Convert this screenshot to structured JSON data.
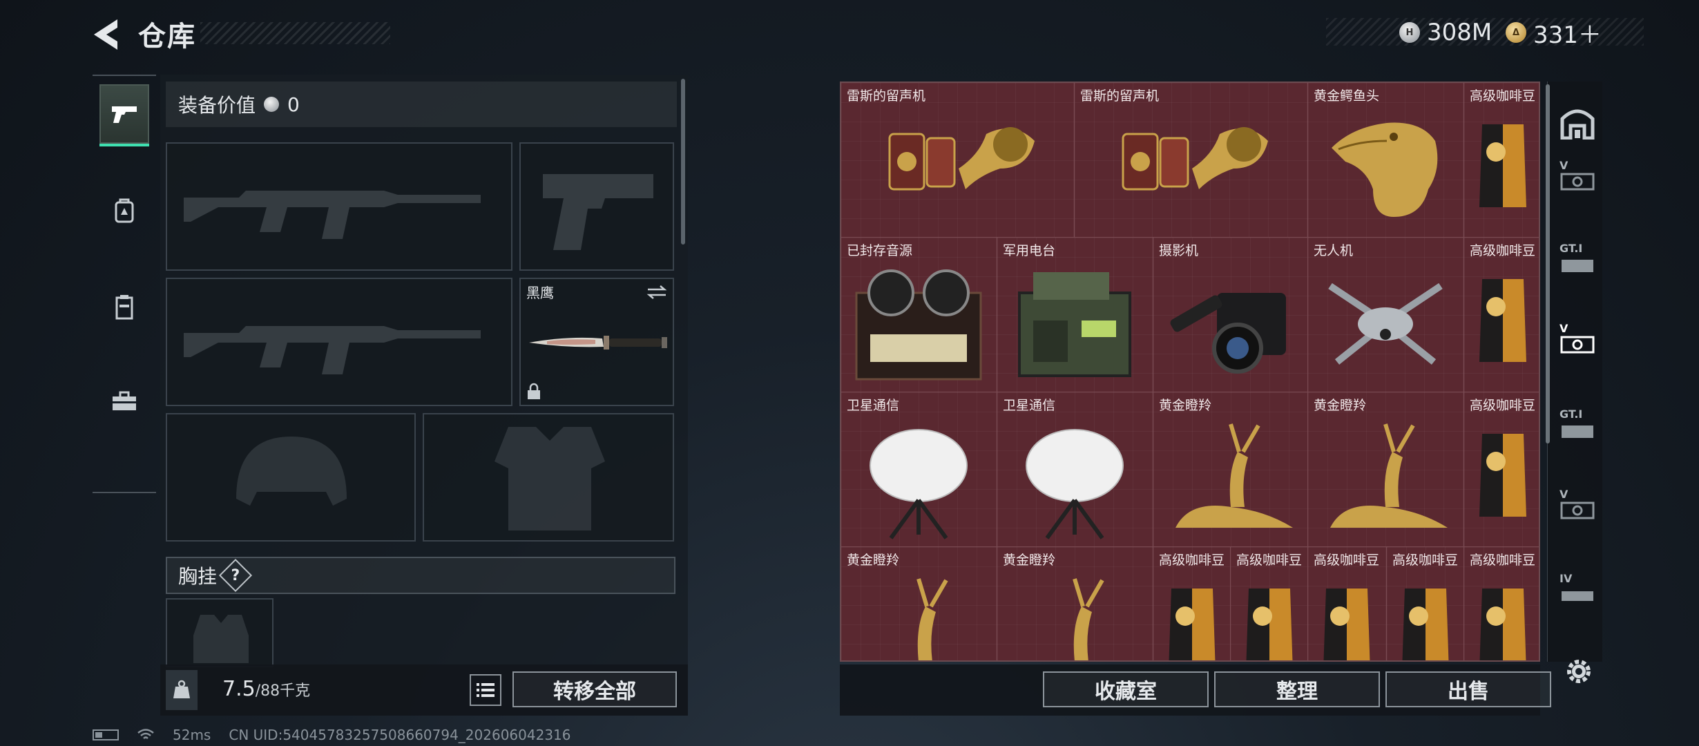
{
  "header": {
    "title": "仓库"
  },
  "currency": [
    {
      "value": "308M",
      "coin": "silver",
      "coin_label": "H"
    },
    {
      "value": "331＋",
      "coin": "gold",
      "coin_label": "Δ"
    }
  ],
  "equipment": {
    "value_label": "装备价值",
    "value": "0",
    "melee_name": "黑鹰",
    "vest_label": "胸挂",
    "help": "?"
  },
  "weight": {
    "current": "7.5",
    "max": "/88千克"
  },
  "buttons": {
    "transfer_all": "转移全部",
    "collection": "收藏室",
    "organize": "整理",
    "sell": "出售"
  },
  "storage_items": [
    {
      "name": "雷斯的留声机",
      "icon": "gramophone-icon"
    },
    {
      "name": "雷斯的留声机",
      "icon": "gramophone-icon"
    },
    {
      "name": "黄金鳄鱼头",
      "icon": "golden-crocodile-head-icon"
    },
    {
      "name": "高级咖啡豆",
      "icon": "coffee-bag-icon"
    },
    {
      "name": "已封存音源",
      "icon": "reel-tape-recorder-icon"
    },
    {
      "name": "军用电台",
      "icon": "military-radio-icon"
    },
    {
      "name": "摄影机",
      "icon": "video-camera-icon"
    },
    {
      "name": "无人机",
      "icon": "drone-icon"
    },
    {
      "name": "高级咖啡豆",
      "icon": "coffee-bag-icon"
    },
    {
      "name": "卫星通信",
      "icon": "satellite-dish-icon"
    },
    {
      "name": "卫星通信",
      "icon": "satellite-dish-icon"
    },
    {
      "name": "黄金瞪羚",
      "icon": "golden-gazelle-icon"
    },
    {
      "name": "黄金瞪羚",
      "icon": "golden-gazelle-icon"
    },
    {
      "name": "高级咖啡豆",
      "icon": "coffee-bag-icon"
    },
    {
      "name": "黄金瞪羚",
      "icon": "golden-gazelle-icon"
    },
    {
      "name": "黄金瞪羚",
      "icon": "golden-gazelle-icon"
    },
    {
      "name": "高级咖啡豆",
      "icon": "coffee-bag-icon"
    },
    {
      "name": "高级咖啡豆",
      "icon": "coffee-bag-icon"
    },
    {
      "name": "高级咖啡豆",
      "icon": "coffee-bag-icon"
    },
    {
      "name": "高级咖啡豆",
      "icon": "coffee-bag-icon"
    },
    {
      "name": "高级咖啡豆",
      "icon": "coffee-bag-icon"
    }
  ],
  "right_tabs": [
    {
      "icon": "storage-overview-icon",
      "label": ""
    },
    {
      "icon": "warehouse-tab-v-icon",
      "label": "V"
    },
    {
      "icon": "warehouse-tab-gti-icon",
      "label": "GT.I"
    },
    {
      "icon": "warehouse-tab-v-active-icon",
      "label": "V"
    },
    {
      "icon": "warehouse-tab-gti-icon",
      "label": "GT.I"
    },
    {
      "icon": "warehouse-tab-v-icon",
      "label": "V"
    },
    {
      "icon": "warehouse-tab-iv-icon",
      "label": "IV"
    }
  ],
  "status": {
    "ping": "52ms",
    "uid": "CN UID:5404578325750866079​4_202606042316"
  },
  "colors": {
    "accent": "#3fe0b0",
    "cell": "#5a2830",
    "gold": "#c9a24a"
  }
}
